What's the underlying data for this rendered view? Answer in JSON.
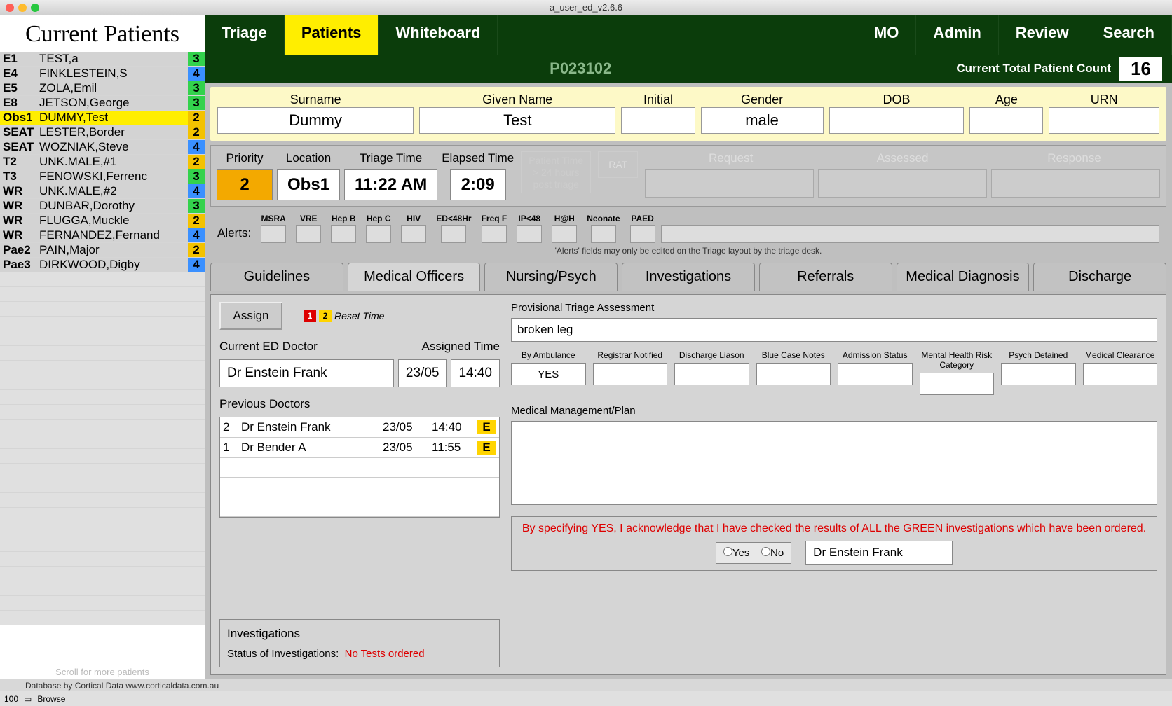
{
  "window_title": "a_user_ed_v2.6.6",
  "sidebar": {
    "title": "Current Patients",
    "scroll_hint": "Scroll for more patients",
    "patients": [
      {
        "loc": "E1",
        "name": "TEST,a",
        "pri": "3",
        "cls": "pri-3"
      },
      {
        "loc": "E4",
        "name": "FINKLESTEIN,S",
        "pri": "4",
        "cls": "pri-4"
      },
      {
        "loc": "E5",
        "name": "ZOLA,Emil",
        "pri": "3",
        "cls": "pri-3"
      },
      {
        "loc": "E8",
        "name": "JETSON,George",
        "pri": "3",
        "cls": "pri-3"
      },
      {
        "loc": "Obs1",
        "name": "DUMMY,Test",
        "pri": "2",
        "cls": "pri-2",
        "selected": true
      },
      {
        "loc": "SEAT",
        "name": "LESTER,Border",
        "pri": "2",
        "cls": "pri-2"
      },
      {
        "loc": "SEAT",
        "name": "WOZNIAK,Steve",
        "pri": "4",
        "cls": "pri-4"
      },
      {
        "loc": "T2",
        "name": "UNK.MALE,#1",
        "pri": "2",
        "cls": "pri-2"
      },
      {
        "loc": "T3",
        "name": "FENOWSKI,Ferrenc",
        "pri": "3",
        "cls": "pri-3"
      },
      {
        "loc": "WR",
        "name": "UNK.MALE,#2",
        "pri": "4",
        "cls": "pri-4"
      },
      {
        "loc": "WR",
        "name": "DUNBAR,Dorothy",
        "pri": "3",
        "cls": "pri-3"
      },
      {
        "loc": "WR",
        "name": "FLUGGA,Muckle",
        "pri": "2",
        "cls": "pri-2"
      },
      {
        "loc": "WR",
        "name": "FERNANDEZ,Fernand",
        "pri": "4",
        "cls": "pri-4"
      },
      {
        "loc": "Pae2",
        "name": "PAIN,Major",
        "pri": "2",
        "cls": "pri-2"
      },
      {
        "loc": "Pae3",
        "name": "DIRKWOOD,Digby",
        "pri": "4",
        "cls": "pri-4"
      }
    ]
  },
  "nav": {
    "triage": "Triage",
    "patients": "Patients",
    "whiteboard": "Whiteboard",
    "mo": "MO",
    "admin": "Admin",
    "review": "Review",
    "search": "Search"
  },
  "pid": "P023102",
  "count_label": "Current Total Patient Count",
  "count": "16",
  "demo_headers": {
    "surname": "Surname",
    "given": "Given Name",
    "initial": "Initial",
    "gender": "Gender",
    "dob": "DOB",
    "age": "Age",
    "urn": "URN"
  },
  "demo": {
    "surname": "Dummy",
    "given": "Test",
    "initial": "",
    "gender": "male",
    "dob": "",
    "age": "",
    "urn": ""
  },
  "tri": {
    "hdr": {
      "priority": "Priority",
      "location": "Location",
      "tt": "Triage Time",
      "et": "Elapsed Time"
    },
    "priority": "2",
    "location": "Obs1",
    "tt": "11:22 AM",
    "et": "2:09",
    "pt_note": "Patient Time > 24 hours post triage",
    "rat": "RAT",
    "rar": {
      "req": "Request",
      "ass": "Assessed",
      "resp": "Response"
    }
  },
  "alerts": {
    "label": "Alerts:",
    "cols": [
      "MSRA",
      "VRE",
      "Hep B",
      "Hep C",
      "HIV",
      "ED<48Hr",
      "Freq F",
      "IP<48",
      "H@H",
      "Neonate",
      "PAED"
    ],
    "note": "'Alerts' fields may only be edited on the Triage layout by the triage desk."
  },
  "tabs": {
    "g": "Guidelines",
    "mo": "Medical Officers",
    "np": "Nursing/Psych",
    "inv": "Investigations",
    "ref": "Referrals",
    "md": "Medical Diagnosis",
    "dis": "Discharge"
  },
  "mo": {
    "assign": "Assign",
    "reset": "Reset Time",
    "cur_lbl": "Current ED Doctor",
    "at_lbl": "Assigned Time",
    "doctor": "Dr Enstein Frank",
    "date": "23/05",
    "time": "14:40",
    "prev_lbl": "Previous Doctors",
    "prev": [
      {
        "n": "2",
        "name": "Dr Enstein Frank",
        "date": "23/05",
        "time": "14:40"
      },
      {
        "n": "1",
        "name": "Dr Bender A",
        "date": "23/05",
        "time": "11:55"
      }
    ],
    "inv_title": "Investigations",
    "inv_status_lbl": "Status of Investigations:",
    "inv_status": "No Tests ordered",
    "pta_lbl": "Provisional Triage Assessment",
    "pta": "broken leg",
    "flags": {
      "amb": {
        "l": "By Ambulance",
        "v": "YES"
      },
      "reg": {
        "l": "Registrar Notified",
        "v": ""
      },
      "dl": {
        "l": "Discharge Liason",
        "v": ""
      },
      "bcn": {
        "l": "Blue Case Notes",
        "v": ""
      },
      "adm": {
        "l": "Admission Status",
        "v": ""
      },
      "mh": {
        "l": "Mental Health Risk Category",
        "v": ""
      },
      "pd": {
        "l": "Psych Detained",
        "v": ""
      },
      "mc": {
        "l": "Medical Clearance",
        "v": ""
      }
    },
    "mmp_lbl": "Medical Management/Plan",
    "ack_txt": "By specifying YES, I acknowledge that I have checked the results of ALL the GREEN investigations which have been ordered.",
    "yes": "Yes",
    "no": "No",
    "ack_doc": "Dr Enstein Frank"
  },
  "credits": "Database by Cortical Data  www.corticaldata.com.au",
  "footer": {
    "zoom": "100",
    "mode": "Browse"
  }
}
